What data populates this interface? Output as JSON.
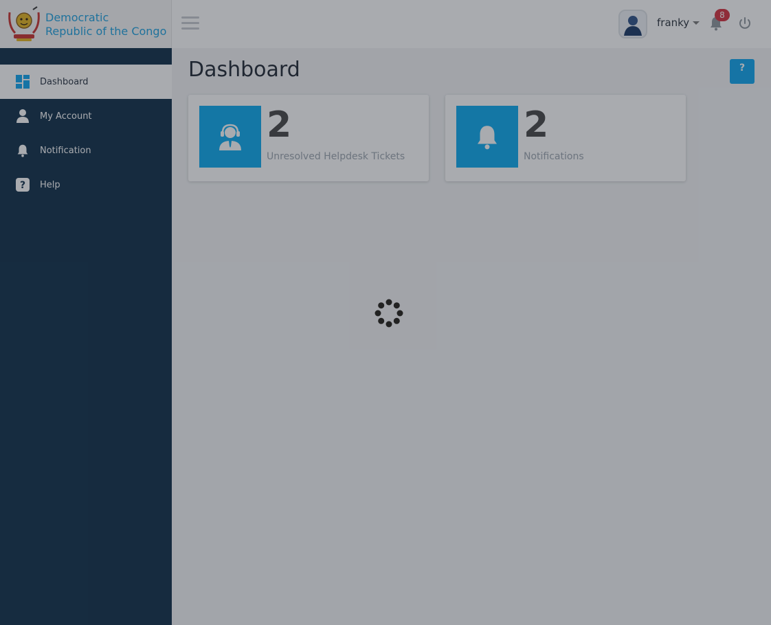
{
  "brand": {
    "line1": "Democratic",
    "line2": "Republic of the Congo",
    "accent": "#1aa0e0"
  },
  "header": {
    "username": "franky",
    "notification_count": "8",
    "menu_icon": "hamburger-icon",
    "power_icon": "power-icon",
    "bell_icon": "bell-icon"
  },
  "sidebar": {
    "background": "#0a2a45",
    "items": [
      {
        "label": "Dashboard",
        "icon": "dashboard-icon",
        "active": true
      },
      {
        "label": "My Account",
        "icon": "user-icon",
        "active": false
      },
      {
        "label": "Notification",
        "icon": "bell-icon",
        "active": false
      },
      {
        "label": "Help",
        "icon": "question-icon",
        "active": false
      }
    ]
  },
  "main": {
    "title": "Dashboard",
    "help_button": "?",
    "cards": [
      {
        "value": "2",
        "label": "Unresolved Helpdesk Tickets",
        "icon": "support-agent-icon"
      },
      {
        "value": "2",
        "label": "Notifications",
        "icon": "bell-icon"
      }
    ],
    "card_color": "#08a9ef"
  },
  "overlay": {
    "loading": true,
    "spinner_icon": "loading-spinner-icon"
  }
}
